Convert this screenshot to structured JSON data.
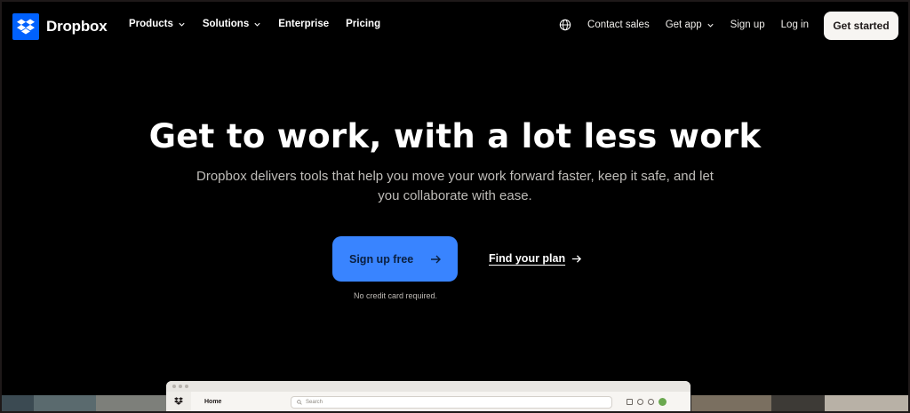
{
  "brand": {
    "name": "Dropbox",
    "accent": "#0061fe"
  },
  "nav": {
    "left": [
      {
        "label": "Products",
        "dropdown": true
      },
      {
        "label": "Solutions",
        "dropdown": true
      },
      {
        "label": "Enterprise",
        "dropdown": false
      },
      {
        "label": "Pricing",
        "dropdown": false
      }
    ],
    "right": {
      "language_icon": "globe-icon",
      "contact_sales": "Contact sales",
      "get_app": "Get app",
      "sign_up": "Sign up",
      "log_in": "Log in",
      "get_started": "Get started"
    }
  },
  "hero": {
    "title": "Get to work, with a lot less work",
    "subtitle": "Dropbox delivers tools that help you move your work forward faster, keep it safe, and let you collaborate with ease.",
    "primary_cta": "Sign up free",
    "secondary_cta": "Find your plan",
    "note": "No credit card required."
  },
  "app_preview": {
    "home_label": "Home",
    "search_placeholder": "Search"
  },
  "colors": {
    "background": "#000000",
    "primary_button": "#3984ff",
    "get_started_button": "#f7f5f2"
  }
}
